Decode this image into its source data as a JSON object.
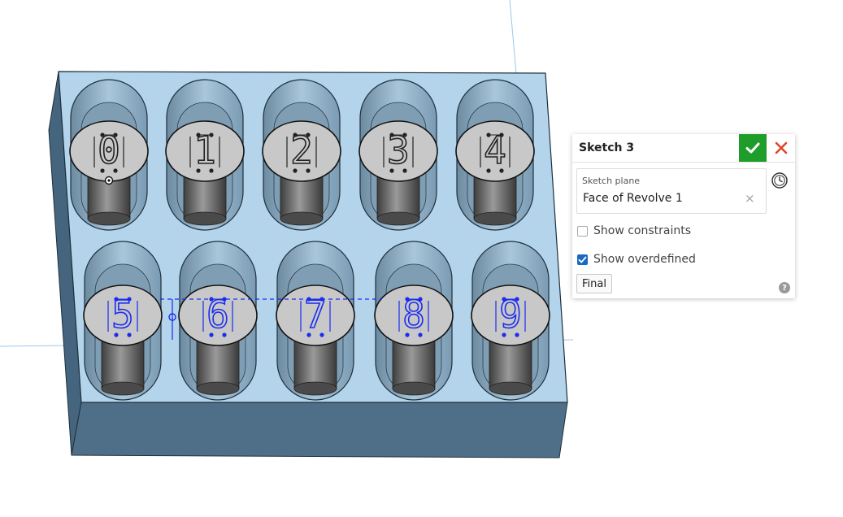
{
  "dialog": {
    "title": "Sketch 3",
    "sketch_plane_label": "Sketch plane",
    "sketch_plane_value": "Face of Revolve 1",
    "show_constraints_label": "Show constraints",
    "show_constraints_checked": false,
    "show_overdefined_label": "Show overdefined",
    "show_overdefined_checked": true,
    "final_label": "Final"
  },
  "model": {
    "digits_row1": [
      "0",
      "1",
      "2",
      "3",
      "4"
    ],
    "digits_row2": [
      "5",
      "6",
      "7",
      "8",
      "9"
    ]
  },
  "colors": {
    "accept": "#1e9d2a",
    "cancel": "#e0462a",
    "checkbox": "#1769c2",
    "model_face": "#b3d4ea",
    "sketch_blue": "#1a2cf0"
  }
}
